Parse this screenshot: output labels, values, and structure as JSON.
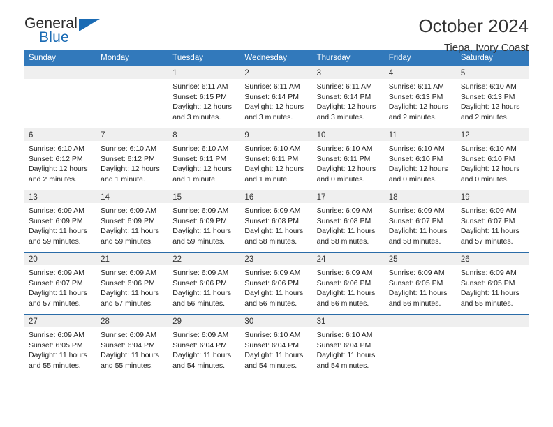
{
  "brand": {
    "name_top": "General",
    "name_bottom": "Blue",
    "accent_color": "#1a6bb4",
    "triangle_icon": "triangle-icon"
  },
  "header": {
    "title": "October 2024",
    "subtitle": "Tiepa, Ivory Coast"
  },
  "calendar": {
    "header_bg": "#3279bb",
    "row_separator_color": "#2a6ca8",
    "daynum_bg": "#efefef",
    "weekday_headers": [
      "Sunday",
      "Monday",
      "Tuesday",
      "Wednesday",
      "Thursday",
      "Friday",
      "Saturday"
    ],
    "labels": {
      "sunrise": "Sunrise:",
      "sunset": "Sunset:",
      "daylight": "Daylight:"
    },
    "weeks": [
      [
        {
          "day": "",
          "blank": true
        },
        {
          "day": "",
          "blank": true
        },
        {
          "day": "1",
          "sunrise": "Sunrise: 6:11 AM",
          "sunset": "Sunset: 6:15 PM",
          "daylight": "Daylight: 12 hours and 3 minutes."
        },
        {
          "day": "2",
          "sunrise": "Sunrise: 6:11 AM",
          "sunset": "Sunset: 6:14 PM",
          "daylight": "Daylight: 12 hours and 3 minutes."
        },
        {
          "day": "3",
          "sunrise": "Sunrise: 6:11 AM",
          "sunset": "Sunset: 6:14 PM",
          "daylight": "Daylight: 12 hours and 3 minutes."
        },
        {
          "day": "4",
          "sunrise": "Sunrise: 6:11 AM",
          "sunset": "Sunset: 6:13 PM",
          "daylight": "Daylight: 12 hours and 2 minutes."
        },
        {
          "day": "5",
          "sunrise": "Sunrise: 6:10 AM",
          "sunset": "Sunset: 6:13 PM",
          "daylight": "Daylight: 12 hours and 2 minutes."
        }
      ],
      [
        {
          "day": "6",
          "sunrise": "Sunrise: 6:10 AM",
          "sunset": "Sunset: 6:12 PM",
          "daylight": "Daylight: 12 hours and 2 minutes."
        },
        {
          "day": "7",
          "sunrise": "Sunrise: 6:10 AM",
          "sunset": "Sunset: 6:12 PM",
          "daylight": "Daylight: 12 hours and 1 minute."
        },
        {
          "day": "8",
          "sunrise": "Sunrise: 6:10 AM",
          "sunset": "Sunset: 6:11 PM",
          "daylight": "Daylight: 12 hours and 1 minute."
        },
        {
          "day": "9",
          "sunrise": "Sunrise: 6:10 AM",
          "sunset": "Sunset: 6:11 PM",
          "daylight": "Daylight: 12 hours and 1 minute."
        },
        {
          "day": "10",
          "sunrise": "Sunrise: 6:10 AM",
          "sunset": "Sunset: 6:11 PM",
          "daylight": "Daylight: 12 hours and 0 minutes."
        },
        {
          "day": "11",
          "sunrise": "Sunrise: 6:10 AM",
          "sunset": "Sunset: 6:10 PM",
          "daylight": "Daylight: 12 hours and 0 minutes."
        },
        {
          "day": "12",
          "sunrise": "Sunrise: 6:10 AM",
          "sunset": "Sunset: 6:10 PM",
          "daylight": "Daylight: 12 hours and 0 minutes."
        }
      ],
      [
        {
          "day": "13",
          "sunrise": "Sunrise: 6:09 AM",
          "sunset": "Sunset: 6:09 PM",
          "daylight": "Daylight: 11 hours and 59 minutes."
        },
        {
          "day": "14",
          "sunrise": "Sunrise: 6:09 AM",
          "sunset": "Sunset: 6:09 PM",
          "daylight": "Daylight: 11 hours and 59 minutes."
        },
        {
          "day": "15",
          "sunrise": "Sunrise: 6:09 AM",
          "sunset": "Sunset: 6:09 PM",
          "daylight": "Daylight: 11 hours and 59 minutes."
        },
        {
          "day": "16",
          "sunrise": "Sunrise: 6:09 AM",
          "sunset": "Sunset: 6:08 PM",
          "daylight": "Daylight: 11 hours and 58 minutes."
        },
        {
          "day": "17",
          "sunrise": "Sunrise: 6:09 AM",
          "sunset": "Sunset: 6:08 PM",
          "daylight": "Daylight: 11 hours and 58 minutes."
        },
        {
          "day": "18",
          "sunrise": "Sunrise: 6:09 AM",
          "sunset": "Sunset: 6:07 PM",
          "daylight": "Daylight: 11 hours and 58 minutes."
        },
        {
          "day": "19",
          "sunrise": "Sunrise: 6:09 AM",
          "sunset": "Sunset: 6:07 PM",
          "daylight": "Daylight: 11 hours and 57 minutes."
        }
      ],
      [
        {
          "day": "20",
          "sunrise": "Sunrise: 6:09 AM",
          "sunset": "Sunset: 6:07 PM",
          "daylight": "Daylight: 11 hours and 57 minutes."
        },
        {
          "day": "21",
          "sunrise": "Sunrise: 6:09 AM",
          "sunset": "Sunset: 6:06 PM",
          "daylight": "Daylight: 11 hours and 57 minutes."
        },
        {
          "day": "22",
          "sunrise": "Sunrise: 6:09 AM",
          "sunset": "Sunset: 6:06 PM",
          "daylight": "Daylight: 11 hours and 56 minutes."
        },
        {
          "day": "23",
          "sunrise": "Sunrise: 6:09 AM",
          "sunset": "Sunset: 6:06 PM",
          "daylight": "Daylight: 11 hours and 56 minutes."
        },
        {
          "day": "24",
          "sunrise": "Sunrise: 6:09 AM",
          "sunset": "Sunset: 6:06 PM",
          "daylight": "Daylight: 11 hours and 56 minutes."
        },
        {
          "day": "25",
          "sunrise": "Sunrise: 6:09 AM",
          "sunset": "Sunset: 6:05 PM",
          "daylight": "Daylight: 11 hours and 56 minutes."
        },
        {
          "day": "26",
          "sunrise": "Sunrise: 6:09 AM",
          "sunset": "Sunset: 6:05 PM",
          "daylight": "Daylight: 11 hours and 55 minutes."
        }
      ],
      [
        {
          "day": "27",
          "sunrise": "Sunrise: 6:09 AM",
          "sunset": "Sunset: 6:05 PM",
          "daylight": "Daylight: 11 hours and 55 minutes."
        },
        {
          "day": "28",
          "sunrise": "Sunrise: 6:09 AM",
          "sunset": "Sunset: 6:04 PM",
          "daylight": "Daylight: 11 hours and 55 minutes."
        },
        {
          "day": "29",
          "sunrise": "Sunrise: 6:09 AM",
          "sunset": "Sunset: 6:04 PM",
          "daylight": "Daylight: 11 hours and 54 minutes."
        },
        {
          "day": "30",
          "sunrise": "Sunrise: 6:10 AM",
          "sunset": "Sunset: 6:04 PM",
          "daylight": "Daylight: 11 hours and 54 minutes."
        },
        {
          "day": "31",
          "sunrise": "Sunrise: 6:10 AM",
          "sunset": "Sunset: 6:04 PM",
          "daylight": "Daylight: 11 hours and 54 minutes."
        },
        {
          "day": "",
          "blank": true
        },
        {
          "day": "",
          "blank": true
        }
      ]
    ]
  }
}
